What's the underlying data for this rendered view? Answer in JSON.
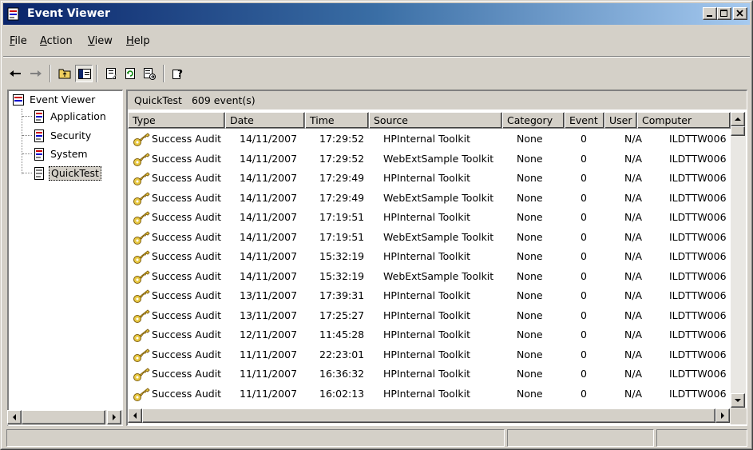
{
  "window": {
    "title": "Event Viewer",
    "title_icon": "event-viewer-icon",
    "controls": [
      "minimize-icon",
      "maximize-icon",
      "close-icon"
    ],
    "colors": {
      "title_start": "#0a246a",
      "title_end": "#a6caf0",
      "face": "#d4d0c8"
    }
  },
  "menu": {
    "items": [
      {
        "label": "File",
        "accel": "F",
        "rest": "ile"
      },
      {
        "label": "Action",
        "accel": "A",
        "rest": "ction"
      },
      {
        "label": "View",
        "accel": "V",
        "rest": "iew"
      },
      {
        "label": "Help",
        "accel": "H",
        "rest": "elp"
      }
    ]
  },
  "toolbar": {
    "buttons": [
      "back-arrow-icon",
      "forward-arrow-icon",
      "up-folder-icon",
      "show-hide-tree-icon",
      "properties-icon",
      "refresh-icon",
      "export-list-icon",
      "help-icon"
    ]
  },
  "tree": {
    "root": "Event Viewer",
    "children": [
      "Application",
      "Security",
      "System",
      "QuickTest"
    ],
    "selected": "QuickTest"
  },
  "list": {
    "caption_name": "QuickTest",
    "caption_count": "609 event(s)",
    "columns": [
      "Type",
      "Date",
      "Time",
      "Source",
      "Category",
      "Event",
      "User",
      "Computer"
    ],
    "rows": [
      [
        "Success Audit",
        "14/11/2007",
        "17:29:52",
        "HPInternal Toolkit",
        "None",
        "0",
        "N/A",
        "ILDTTW006"
      ],
      [
        "Success Audit",
        "14/11/2007",
        "17:29:52",
        "WebExtSample Toolkit",
        "None",
        "0",
        "N/A",
        "ILDTTW006"
      ],
      [
        "Success Audit",
        "14/11/2007",
        "17:29:49",
        "HPInternal Toolkit",
        "None",
        "0",
        "N/A",
        "ILDTTW006"
      ],
      [
        "Success Audit",
        "14/11/2007",
        "17:29:49",
        "WebExtSample Toolkit",
        "None",
        "0",
        "N/A",
        "ILDTTW006"
      ],
      [
        "Success Audit",
        "14/11/2007",
        "17:19:51",
        "HPInternal Toolkit",
        "None",
        "0",
        "N/A",
        "ILDTTW006"
      ],
      [
        "Success Audit",
        "14/11/2007",
        "17:19:51",
        "WebExtSample Toolkit",
        "None",
        "0",
        "N/A",
        "ILDTTW006"
      ],
      [
        "Success Audit",
        "14/11/2007",
        "15:32:19",
        "HPInternal Toolkit",
        "None",
        "0",
        "N/A",
        "ILDTTW006"
      ],
      [
        "Success Audit",
        "14/11/2007",
        "15:32:19",
        "WebExtSample Toolkit",
        "None",
        "0",
        "N/A",
        "ILDTTW006"
      ],
      [
        "Success Audit",
        "13/11/2007",
        "17:39:31",
        "HPInternal Toolkit",
        "None",
        "0",
        "N/A",
        "ILDTTW006"
      ],
      [
        "Success Audit",
        "13/11/2007",
        "17:25:27",
        "HPInternal Toolkit",
        "None",
        "0",
        "N/A",
        "ILDTTW006"
      ],
      [
        "Success Audit",
        "12/11/2007",
        "11:45:28",
        "HPInternal Toolkit",
        "None",
        "0",
        "N/A",
        "ILDTTW006"
      ],
      [
        "Success Audit",
        "11/11/2007",
        "22:23:01",
        "HPInternal Toolkit",
        "None",
        "0",
        "N/A",
        "ILDTTW006"
      ],
      [
        "Success Audit",
        "11/11/2007",
        "16:36:32",
        "HPInternal Toolkit",
        "None",
        "0",
        "N/A",
        "ILDTTW006"
      ],
      [
        "Success Audit",
        "11/11/2007",
        "16:02:13",
        "HPInternal Toolkit",
        "None",
        "0",
        "N/A",
        "ILDTTW006"
      ]
    ],
    "row_icon": "key-icon"
  },
  "statusbar": {
    "panels": [
      "",
      "",
      ""
    ]
  }
}
